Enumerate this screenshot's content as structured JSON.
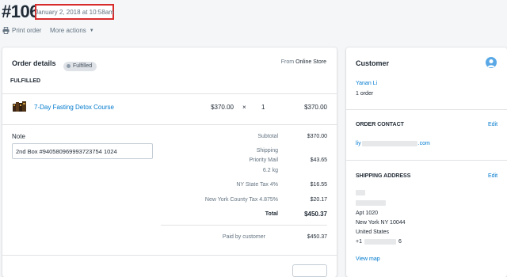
{
  "header": {
    "order_number": "#1060",
    "date": "January 2, 2018 at 10:58am",
    "print_order": "Print order",
    "more_actions": "More actions"
  },
  "order": {
    "title": "Order details",
    "status_badge": "Fulfilled",
    "from_label": "From",
    "source": "Online Store",
    "section_label": "FULFILLED",
    "item": {
      "name": "7-Day Fasting Detox Course",
      "price": "$370.00",
      "times": "×",
      "quantity": "1",
      "total": "$370.00"
    },
    "note_label": "Note",
    "note_value": "2nd Box #940580969993723754 1024",
    "summary": {
      "subtotal_label": "Subtotal",
      "subtotal_value": "$370.00",
      "shipping_label": "Shipping",
      "shipping_method": "Priority Mail",
      "shipping_weight": "6.2 kg",
      "shipping_value": "$43.65",
      "tax1_label": "NY State Tax 4%",
      "tax1_value": "$16.55",
      "tax2_label": "New York County Tax 4.875%",
      "tax2_value": "$20.17",
      "total_label": "Total",
      "total_value": "$450.37",
      "paid_label": "Paid by customer",
      "paid_value": "$450.37"
    }
  },
  "customer": {
    "title": "Customer",
    "name": "Yanan Li",
    "orders": "1 order",
    "contact_title": "ORDER CONTACT",
    "contact_edit": "Edit",
    "email_start": "liy",
    "email_end": ".com",
    "shipping_title": "SHIPPING ADDRESS",
    "shipping_edit": "Edit",
    "address_line1": "Apt 1020",
    "address_line2": "New York NY 10044",
    "address_country": "United States",
    "phone_start": "+1",
    "phone_end": "6",
    "view_map": "View map"
  },
  "colors": {
    "link": "#007ace",
    "highlight_border": "#d82c2c",
    "badge_bg": "#dfe3e8"
  }
}
